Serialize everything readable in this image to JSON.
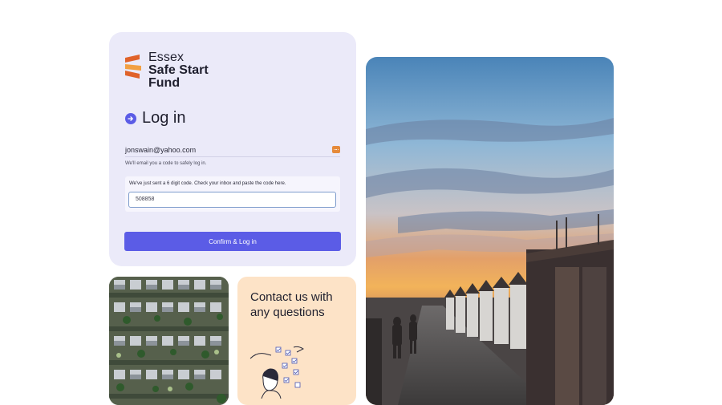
{
  "logo": {
    "line1": "Essex",
    "line2": "Safe Start",
    "line3": "Fund",
    "colors": {
      "mark_dark": "#e0622a",
      "mark_light": "#f2a043"
    }
  },
  "login": {
    "title": "Log in",
    "email_value": "jonswain@yahoo.com",
    "autofill_icon": "autofill-key-icon",
    "helper_text": "We'll email you a code to safely log in.",
    "code_message": "We've just sent a 6 digit code. Check your inbox and paste the code here.",
    "code_value": "508858",
    "submit_label": "Confirm & Log in"
  },
  "contact": {
    "heading": "Contact us with any questions"
  },
  "colors": {
    "accent": "#5b5ce6",
    "login_card_bg": "#ebeaf9",
    "contact_card_bg": "#fde3c7",
    "autofill_icon": "#e58a3b"
  }
}
